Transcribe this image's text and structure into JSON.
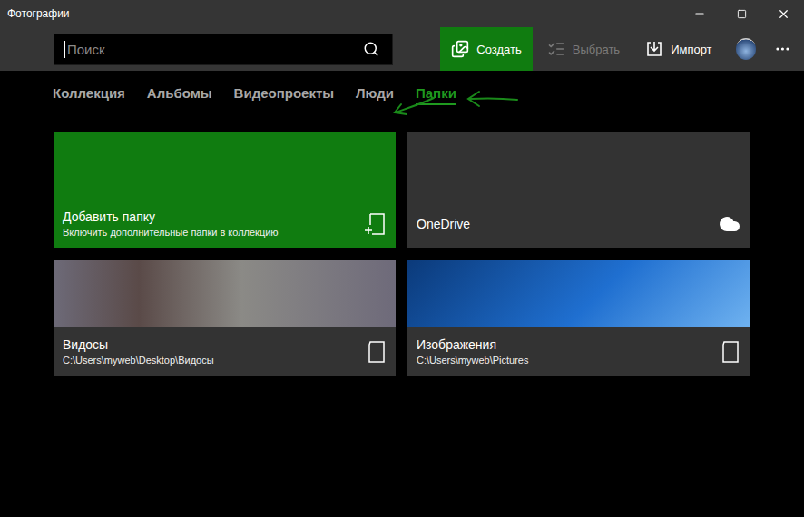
{
  "window": {
    "title": "Фотографии"
  },
  "search": {
    "placeholder": "Поиск"
  },
  "toolbar": [
    {
      "label": "Создать",
      "kind": "create",
      "primary": true,
      "disabled": false
    },
    {
      "label": "Выбрать",
      "kind": "select",
      "primary": false,
      "disabled": true
    },
    {
      "label": "Импорт",
      "kind": "import",
      "primary": false,
      "disabled": false
    }
  ],
  "tabs": [
    {
      "label": "Коллекция",
      "selected": false
    },
    {
      "label": "Альбомы",
      "selected": false
    },
    {
      "label": "Видеопроекты",
      "selected": false
    },
    {
      "label": "Люди",
      "selected": false
    },
    {
      "label": "Папки",
      "selected": true
    }
  ],
  "folders": [
    {
      "kind": "add",
      "title": "Добавить папку",
      "subtitle": "Включить дополнительные папки в коллекцию"
    },
    {
      "kind": "cloud",
      "title": "OneDrive",
      "subtitle": ""
    },
    {
      "kind": "local",
      "title": "Видосы",
      "subtitle": "C:\\Users\\myweb\\Desktop\\Видосы"
    },
    {
      "kind": "local",
      "title": "Изображения",
      "subtitle": "C:\\Users\\myweb\\Pictures"
    }
  ]
}
